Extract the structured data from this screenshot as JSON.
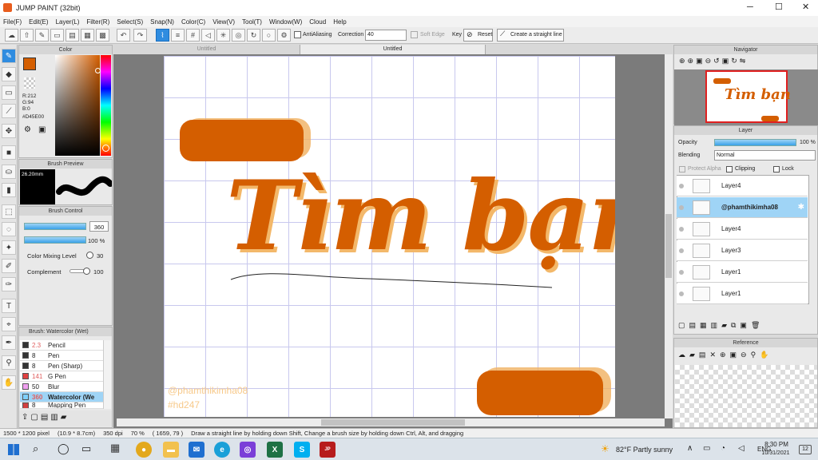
{
  "app": {
    "title": "JUMP PAINT (32bit)"
  },
  "menu": [
    "File(F)",
    "Edit(E)",
    "Layer(L)",
    "Filter(R)",
    "Select(S)",
    "Snap(N)",
    "Color(C)",
    "View(V)",
    "Tool(T)",
    "Window(W)",
    "Cloud",
    "Help"
  ],
  "toolbar": {
    "antialias_label": "AntiAliasing",
    "correction_label": "Correction",
    "correction_value": "40",
    "soft_edge_label": "Soft Edge",
    "key_label": "Key",
    "reset_label": "Reset",
    "straight_line_label": "Create a straight line"
  },
  "color_panel": {
    "title": "Color",
    "r": "R:212",
    "g": "G:94",
    "b": "B:0",
    "hex": "#D45E00",
    "current": "#D45E00"
  },
  "brush_preview": {
    "title": "Brush Preview",
    "size": "26.20mm"
  },
  "brush_control": {
    "title": "Brush Control",
    "size_value": "360",
    "opacity_value": "100 %",
    "mixing_label": "Color Mixing Level",
    "mixing_value": "30",
    "complement_label": "Complement",
    "complement_value": "100"
  },
  "brush_list": {
    "title": "Brush: Watercolor (Wet)",
    "items": [
      {
        "size": "2.3",
        "name": "Pencil",
        "color": "#333333"
      },
      {
        "size": "8",
        "name": "Pen",
        "color": "#333333"
      },
      {
        "size": "8",
        "name": "Pen (Sharp)",
        "color": "#333333"
      },
      {
        "size": "141",
        "name": "G Pen",
        "color": "#e04040"
      },
      {
        "size": "50",
        "name": "Blur",
        "color": "#f0a0f0"
      },
      {
        "size": "360",
        "name": "Watercolor (We",
        "color": "#7fd0ff"
      },
      {
        "size": "8",
        "name": "Mapping Pen",
        "color": "#d04040"
      }
    ]
  },
  "canvas": {
    "tab_left": "Untitled",
    "tab_right": "Untitled",
    "title_text": "Tìm bạn",
    "watermark1": "@phamthikimha08",
    "watermark2": "#hd247",
    "accent": "#D45E00"
  },
  "navigator": {
    "title": "Navigator"
  },
  "layer_panel": {
    "title": "Layer",
    "opacity_label": "Opacity",
    "opacity_value": "100 %",
    "blending_label": "Blending",
    "blending_value": "Normal",
    "protect_alpha": "Protect Alpha",
    "clipping": "Clipping",
    "lock": "Lock",
    "layers": [
      "Layer4",
      "@phamthikimha08",
      "Layer4",
      "Layer3",
      "Layer1",
      "Layer1"
    ]
  },
  "reference": {
    "title": "Reference"
  },
  "status": {
    "size": "1500 * 1200 pixel",
    "physical": "(10.9 * 8.7cm)",
    "dpi": "350 dpi",
    "zoom": "70 %",
    "cursor": "( 1659, 79 )",
    "hint": "Draw a straight line by holding down Shift, Change a brush size by holding down Ctrl, Alt, and dragging"
  },
  "taskbar": {
    "weather": "82°F  Partly sunny",
    "lang": "ENG",
    "time": "8:30 PM",
    "date": "10/31/2021",
    "notif": "12"
  }
}
